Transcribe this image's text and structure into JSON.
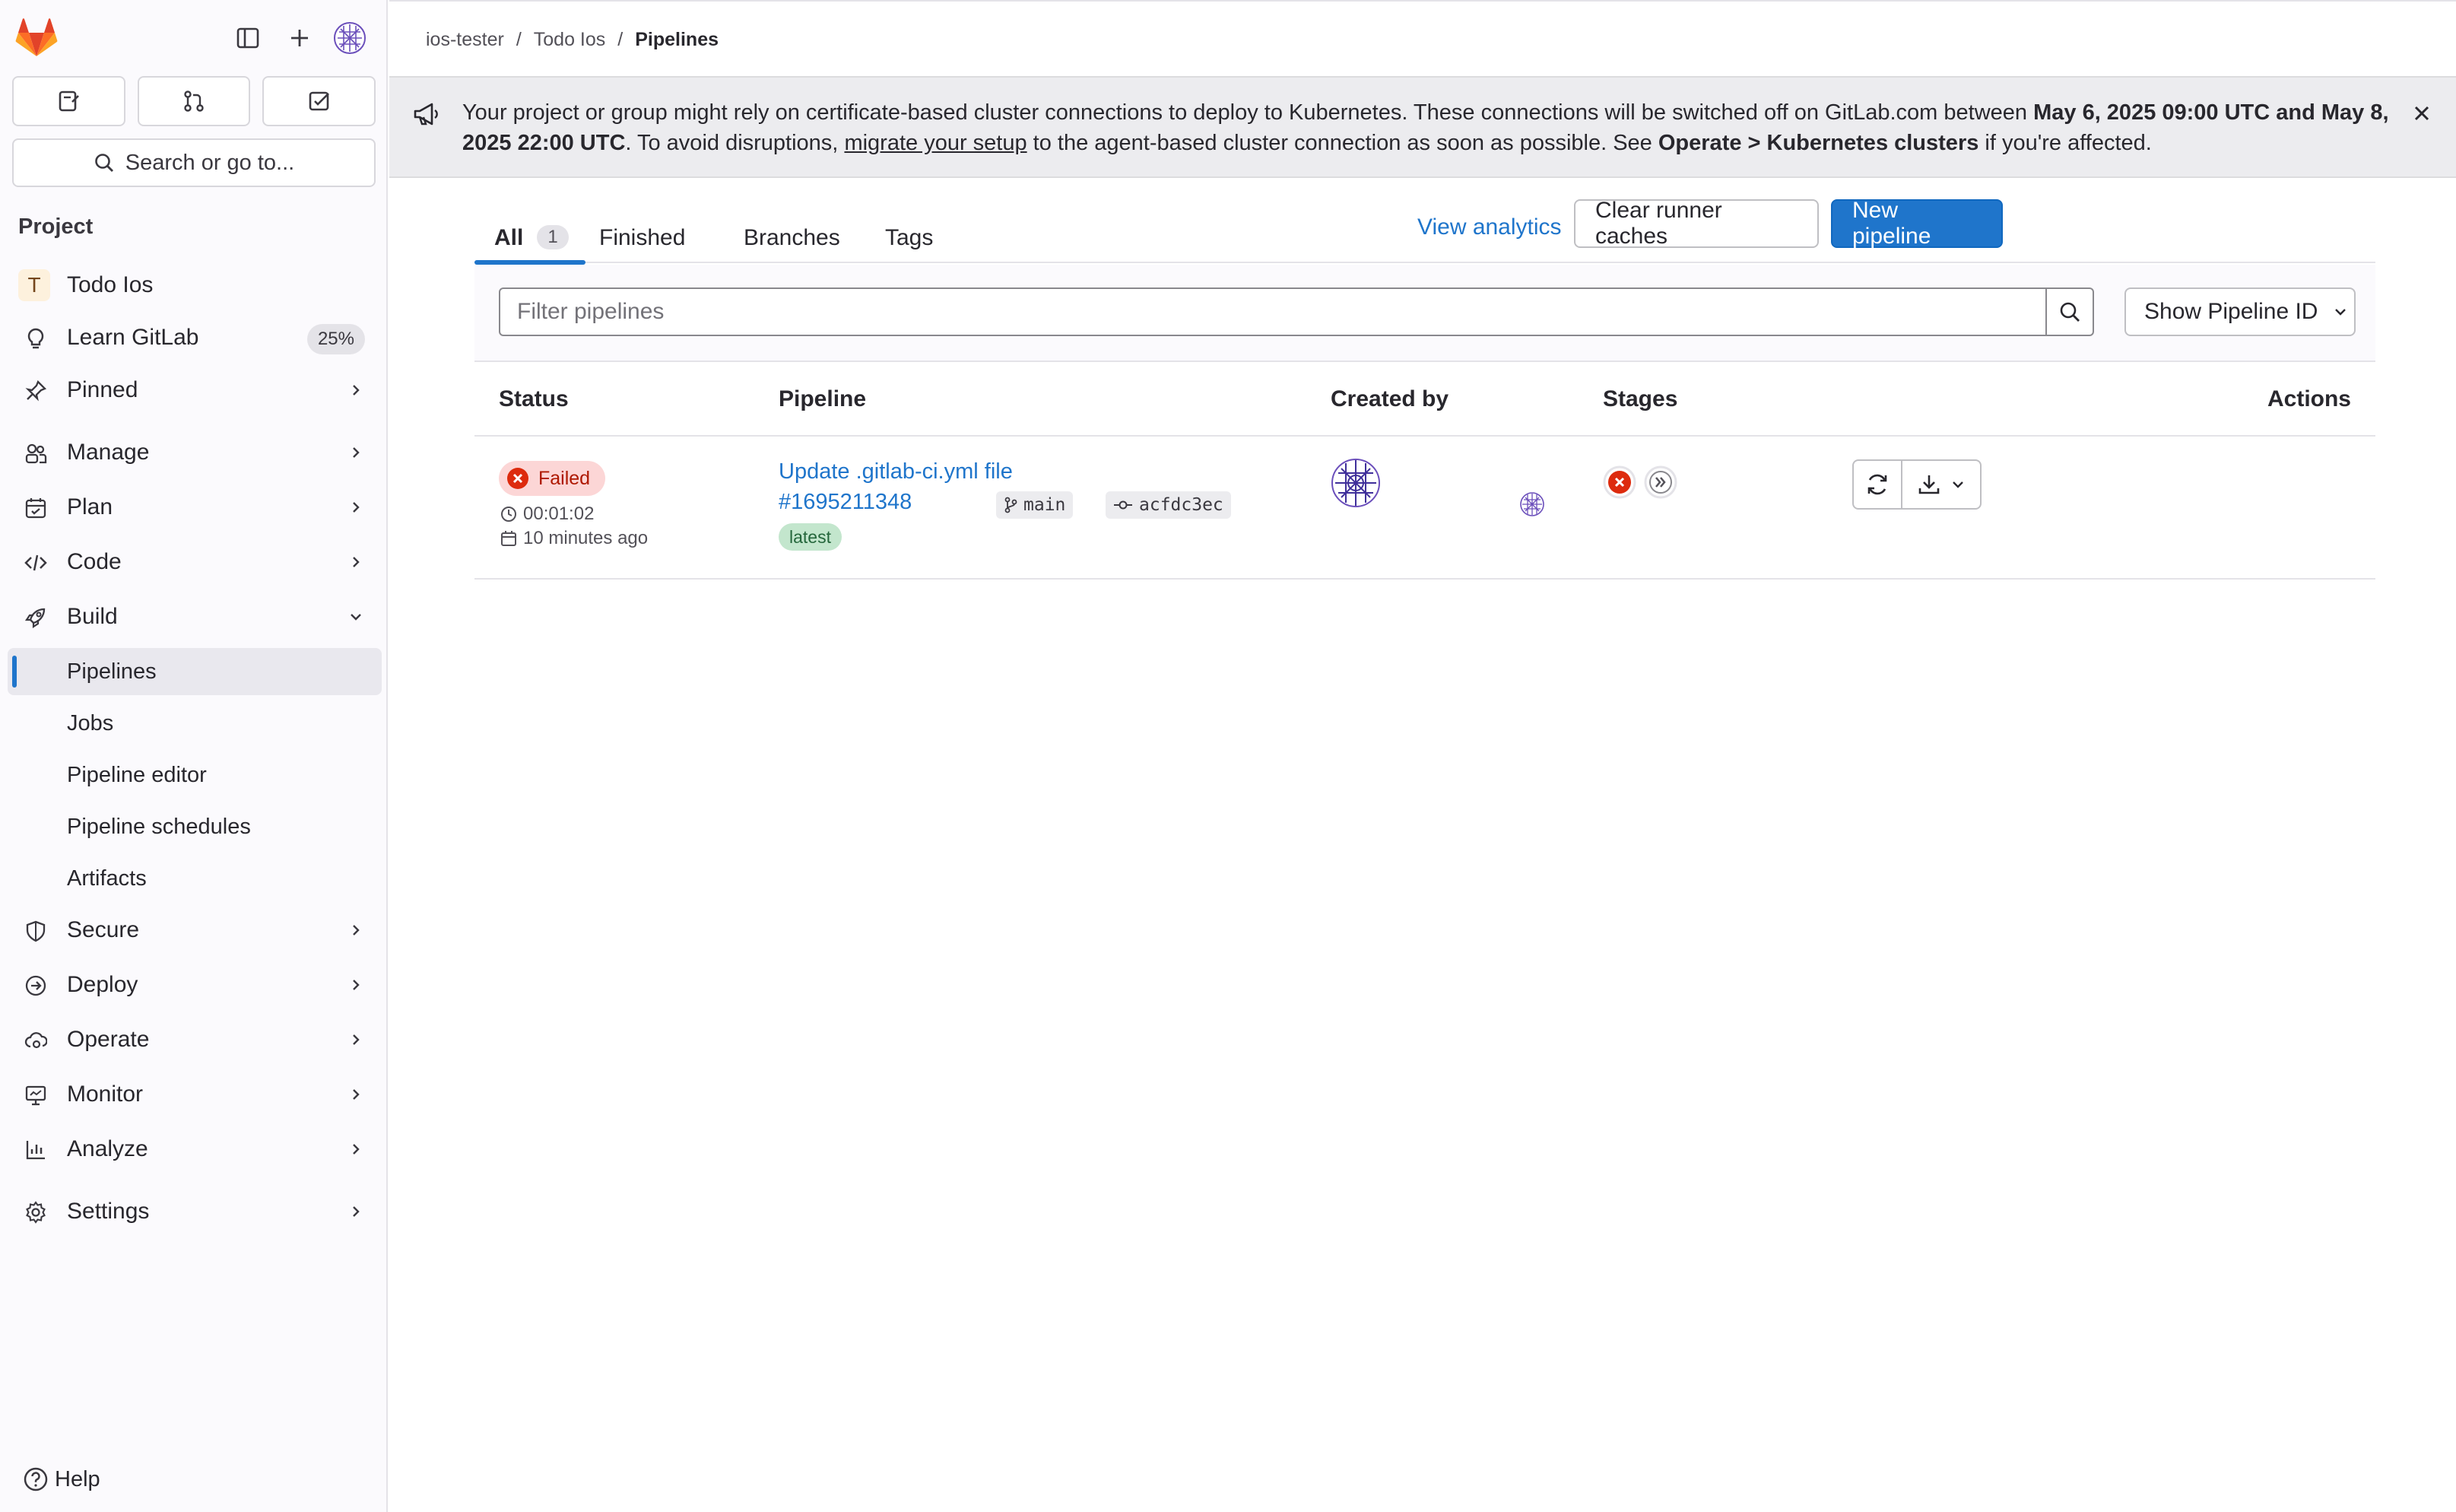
{
  "sidebar": {
    "search_label": "Search or go to...",
    "heading": "Project",
    "project": {
      "initial": "T",
      "name": "Todo Ios"
    },
    "learn": {
      "label": "Learn GitLab",
      "progress": "25%"
    },
    "items": {
      "pinned": "Pinned",
      "manage": "Manage",
      "plan": "Plan",
      "code": "Code",
      "build": "Build",
      "secure": "Secure",
      "deploy": "Deploy",
      "operate": "Operate",
      "monitor": "Monitor",
      "analyze": "Analyze",
      "settings": "Settings"
    },
    "build_sub": {
      "pipelines": "Pipelines",
      "jobs": "Jobs",
      "pipeline_editor": "Pipeline editor",
      "pipeline_schedules": "Pipeline schedules",
      "artifacts": "Artifacts"
    },
    "help": "Help"
  },
  "breadcrumb": {
    "items": [
      "ios-tester",
      "Todo Ios",
      "Pipelines"
    ],
    "separator": "/"
  },
  "banner": {
    "part1": "Your project or group might rely on certificate-based cluster connections to deploy to Kubernetes. These connections will be switched off on GitLab.com between ",
    "date1": "May 6, 2025 09:00 UTC and May 8, 2025 22:00 UTC",
    "part2": ". To avoid disruptions, ",
    "link": "migrate your setup",
    "part3": " to the agent-based cluster connection as soon as possible. See ",
    "bold2": "Operate > Kubernetes clusters",
    "part4": " if you're affected."
  },
  "tabs": {
    "all": "All",
    "all_count": "1",
    "finished": "Finished",
    "branches": "Branches",
    "tags": "Tags"
  },
  "actions": {
    "view_analytics": "View analytics",
    "clear_caches": "Clear runner caches",
    "new_pipeline": "New pipeline"
  },
  "filter": {
    "placeholder": "Filter pipelines",
    "show_id": "Show Pipeline ID"
  },
  "table": {
    "headers": {
      "status": "Status",
      "pipeline": "Pipeline",
      "created_by": "Created by",
      "stages": "Stages",
      "actions": "Actions"
    },
    "rows": [
      {
        "status": "Failed",
        "duration": "00:01:02",
        "finished": "10 minutes ago",
        "title": "Update .gitlab-ci.yml file",
        "id": "#1695211348",
        "branch": "main",
        "commit": "acfdc3ec",
        "tag": "latest"
      }
    ]
  },
  "colors": {
    "accent": "#1f75cb",
    "failed": "#dd2b0e",
    "failed_bg": "#fcd6d6",
    "success_bg": "#c3e6cd",
    "sidebar_bg": "#fbfafd",
    "logo_orange": "#fc6d26",
    "avatar_purple": "#6b4fbb"
  }
}
